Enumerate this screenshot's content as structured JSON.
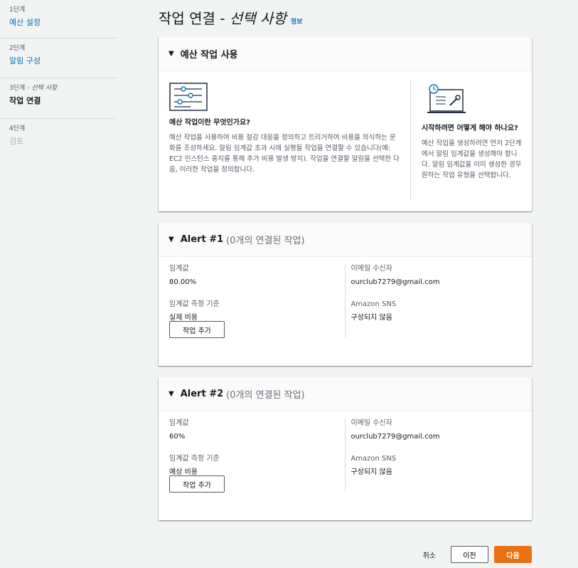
{
  "steps": [
    {
      "num": "1단계",
      "label": "예산 설정",
      "state": "link"
    },
    {
      "num": "2단계",
      "label": "알림 구성",
      "state": "link"
    },
    {
      "num": "3단계",
      "num_suffix": "선택 사항",
      "label": "작업 연결",
      "state": "current"
    },
    {
      "num": "4단계",
      "label": "검토",
      "state": "disabled"
    }
  ],
  "title": {
    "main": "작업 연결 - ",
    "optional": "선택 사항",
    "info": "정보"
  },
  "intro": {
    "title": "예산 작업 사용",
    "left_heading": "예산 작업이란 무엇인가요?",
    "left_text": "예산 작업을 사용하여 비용 절감 대응을 정의하고 트리거하여 비용을 의식하는 문화를 조성하세요. 알림 임계값 초과 시에 실행될 작업을 연결할 수 있습니다(예: EC2 인스턴스 중지를 통해 추가 비용 발생 방지). 작업을 연결할 알림을 선택한 다음, 이러한 작업을 정의합니다.",
    "right_heading": "시작하려면 어떻게 해야 하나요?",
    "right_text": "예산 작업을 생성하려면 먼저 2단계에서 알림 임계값을 생성해야 합니다. 알림 임계값을 이미 생성한 경우 원하는 작업 유형을 선택합니다."
  },
  "alerts": [
    {
      "title": "Alert #1",
      "sub": "(0개의 연결된 작업)",
      "threshold_label": "임계값",
      "threshold_value": "80.00%",
      "basis_label": "임계값 측정 기준",
      "basis_value": "실제 비용",
      "email_label": "이메일 수신자",
      "email_value": "ourclub7279@gmail.com",
      "sns_label": "Amazon SNS",
      "sns_value": "구성되지 않음",
      "add_button": "작업 추가"
    },
    {
      "title": "Alert #2",
      "sub": "(0개의 연결된 작업)",
      "threshold_label": "임계값",
      "threshold_value": "60%",
      "basis_label": "임계값 측정 기준",
      "basis_value": "예상 비용",
      "email_label": "이메일 수신자",
      "email_value": "ourclub7279@gmail.com",
      "sns_label": "Amazon SNS",
      "sns_value": "구성되지 않음",
      "add_button": "작업 추가"
    }
  ],
  "footer": {
    "cancel": "취소",
    "prev": "이전",
    "next": "다음"
  },
  "colors": {
    "link": "#0073bb",
    "primary": "#ec7211",
    "background": "#f2f3f3"
  }
}
